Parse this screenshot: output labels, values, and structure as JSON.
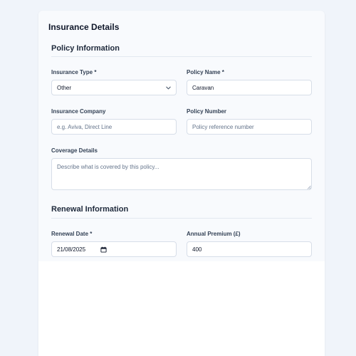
{
  "card_title": "Insurance Details",
  "policy_section": {
    "title": "Policy Information",
    "insurance_type": {
      "label": "Insurance Type *",
      "value": "Other"
    },
    "policy_name": {
      "label": "Policy Name *",
      "value": "Caravan"
    },
    "insurance_company": {
      "label": "Insurance Company",
      "placeholder": "e.g. Aviva, Direct Line"
    },
    "policy_number": {
      "label": "Policy Number",
      "placeholder": "Policy reference number"
    },
    "coverage": {
      "label": "Coverage Details",
      "placeholder": "Describe what is covered by this policy..."
    }
  },
  "renewal_section": {
    "title": "Renewal Information",
    "renewal_date": {
      "label": "Renewal Date *",
      "value": "21/08/2025"
    },
    "annual_premium": {
      "label": "Annual Premium (£)",
      "value": "400"
    }
  }
}
